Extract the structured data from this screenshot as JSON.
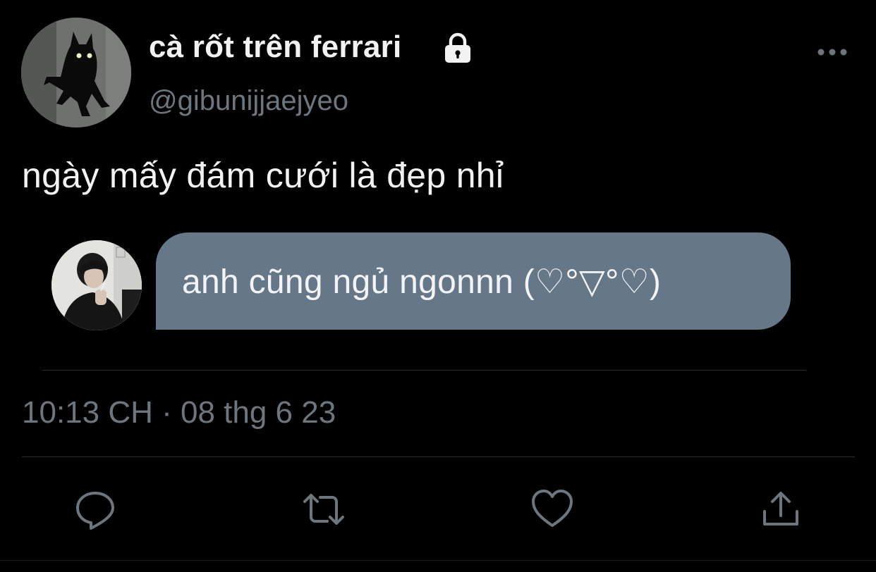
{
  "tweet": {
    "display_name": "cà rốt trên ferrari",
    "handle": "@gibunijjaejyeo",
    "text": "ngày mấy đám cưới là đẹp nhỉ",
    "quoted_message": "anh cũng ngủ ngonnn (♡°▽°♡)",
    "timestamp": "10:13 CH · 08 thg 6 23"
  },
  "icons": {
    "lock": "lock-icon",
    "more": "more-horizontal-icon",
    "reply": "speech-bubble-icon",
    "retweet": "retweet-arrows-icon",
    "like": "heart-icon",
    "share": "share-upload-icon"
  },
  "colors": {
    "background": "#000000",
    "text_primary": "#f2f2f2",
    "text_secondary": "#6e767d",
    "bubble": "#667788",
    "icon": "#6e767d"
  }
}
